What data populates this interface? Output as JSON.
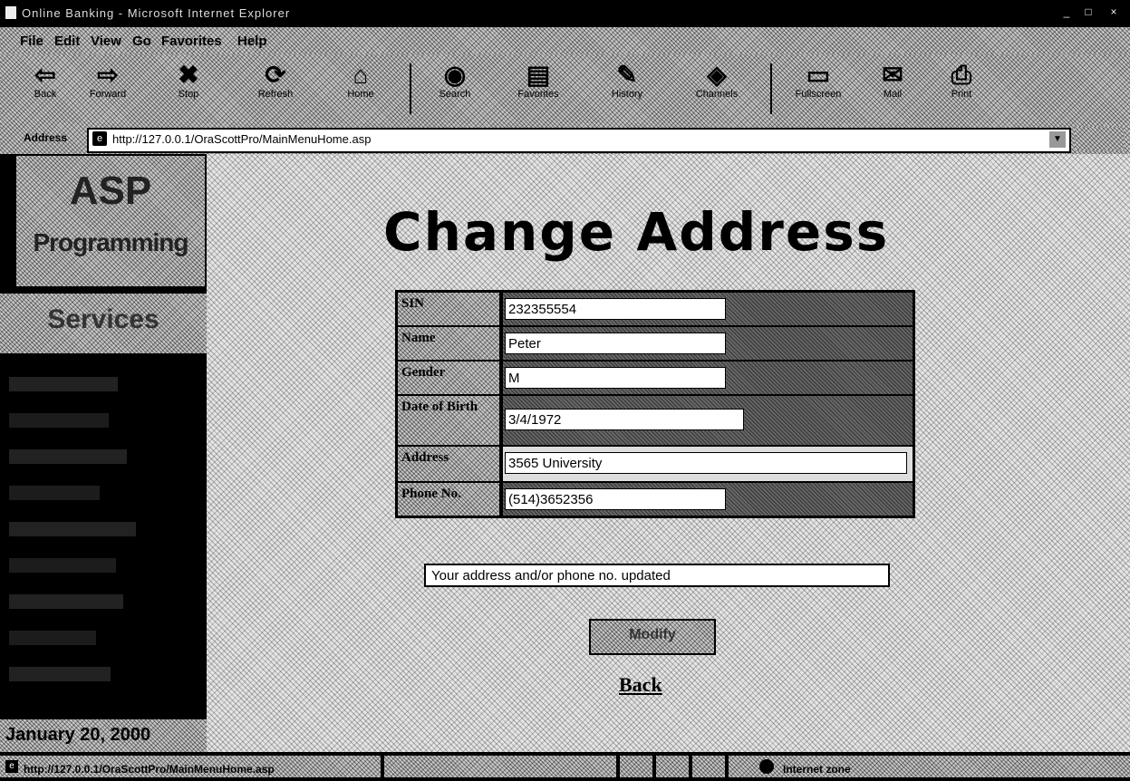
{
  "window": {
    "title": "Online Banking - Microsoft Internet Explorer"
  },
  "menu": {
    "items": [
      "File",
      "Edit",
      "View",
      "Go",
      "Favorites",
      "Help"
    ]
  },
  "toolbar": {
    "buttons": [
      {
        "label": "Back",
        "icon": "back-arrow-icon"
      },
      {
        "label": "Forward",
        "icon": "forward-arrow-icon"
      },
      {
        "label": "Stop",
        "icon": "stop-icon"
      },
      {
        "label": "Refresh",
        "icon": "refresh-icon"
      },
      {
        "label": "Home",
        "icon": "home-icon"
      },
      {
        "label": "Search",
        "icon": "search-icon"
      },
      {
        "label": "Favorites",
        "icon": "favorites-icon"
      },
      {
        "label": "History",
        "icon": "history-icon"
      },
      {
        "label": "Channels",
        "icon": "channels-icon"
      },
      {
        "label": "Fullscreen",
        "icon": "fullscreen-icon"
      },
      {
        "label": "Mail",
        "icon": "mail-icon"
      },
      {
        "label": "Print",
        "icon": "print-icon"
      }
    ]
  },
  "address": {
    "label": "Address",
    "url": "http://127.0.0.1/OraScottPro/MainMenuHome.asp"
  },
  "sidebar": {
    "logo_title": "ASP",
    "logo_subtitle": "Programming",
    "section_label": "Services",
    "date": "January 20, 2000"
  },
  "main": {
    "title": "Change Address",
    "form": {
      "ssn_label": "SIN",
      "ssn_value": "232355554",
      "name_label": "Name",
      "name_value": "Peter",
      "gender_label": "Gender",
      "gender_value": "M",
      "dob_label": "Date of Birth",
      "dob_value": "3/4/1972",
      "address_label": "Address",
      "address_value": "3565 University",
      "phone_label": "Phone No.",
      "phone_value": "(514)3652356"
    },
    "status_message": "Your address and/or phone no. updated",
    "modify_label": "Modify",
    "back_label": "Back"
  },
  "statusbar": {
    "text": "http://127.0.0.1/OraScottPro/MainMenuHome.asp",
    "zone": "Internet zone"
  }
}
